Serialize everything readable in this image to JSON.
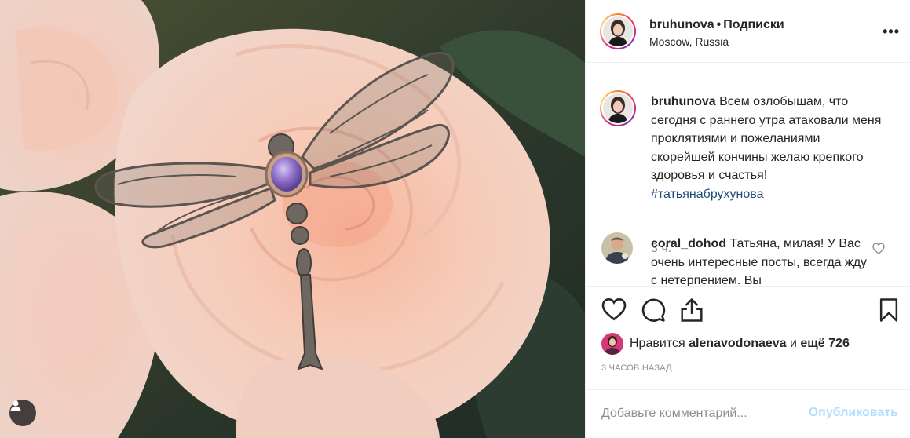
{
  "photo": {
    "alt_subject": "",
    "user_tags_icon": "person-icon"
  },
  "header": {
    "username": "bruhunova",
    "separator": "•",
    "follow_label": "Подписки",
    "location": "Moscow, Russia",
    "more_icon": "more-horizontal-icon",
    "more_label": "•••"
  },
  "caption": {
    "username": "bruhunova",
    "text": "Всем озлобышам, что сегодня с раннего утра атаковали меня проклятиями и пожеланиями скорейшей кончины желаю крепкого здоровья и счастья!",
    "hashtag": "#татьянабрухунова",
    "time": "3 ч."
  },
  "comments": [
    {
      "username": "coral_dohod",
      "text": "Татьяна, милая! У Вас очень интересные посты, всегда жду с нетерпением. Вы",
      "like_icon": "heart-outline-icon"
    }
  ],
  "actions": {
    "like_icon": "heart-outline-icon",
    "comment_icon": "comment-bubble-icon",
    "share_icon": "share-upload-icon",
    "save_icon": "bookmark-icon"
  },
  "likes": {
    "prefix": "Нравится",
    "liker": "alenavodonaeva",
    "middle": "и",
    "rest": "ещё 726"
  },
  "posted_ago": "3 ЧАСОВ НАЗАД",
  "add_comment": {
    "placeholder": "Добавьте комментарий...",
    "publish_label": "Опубликовать"
  },
  "colors": {
    "link": "#1e4a7a",
    "muted": "#8e8e8e",
    "publish_disabled": "#b2dffc",
    "border": "#efefef"
  }
}
